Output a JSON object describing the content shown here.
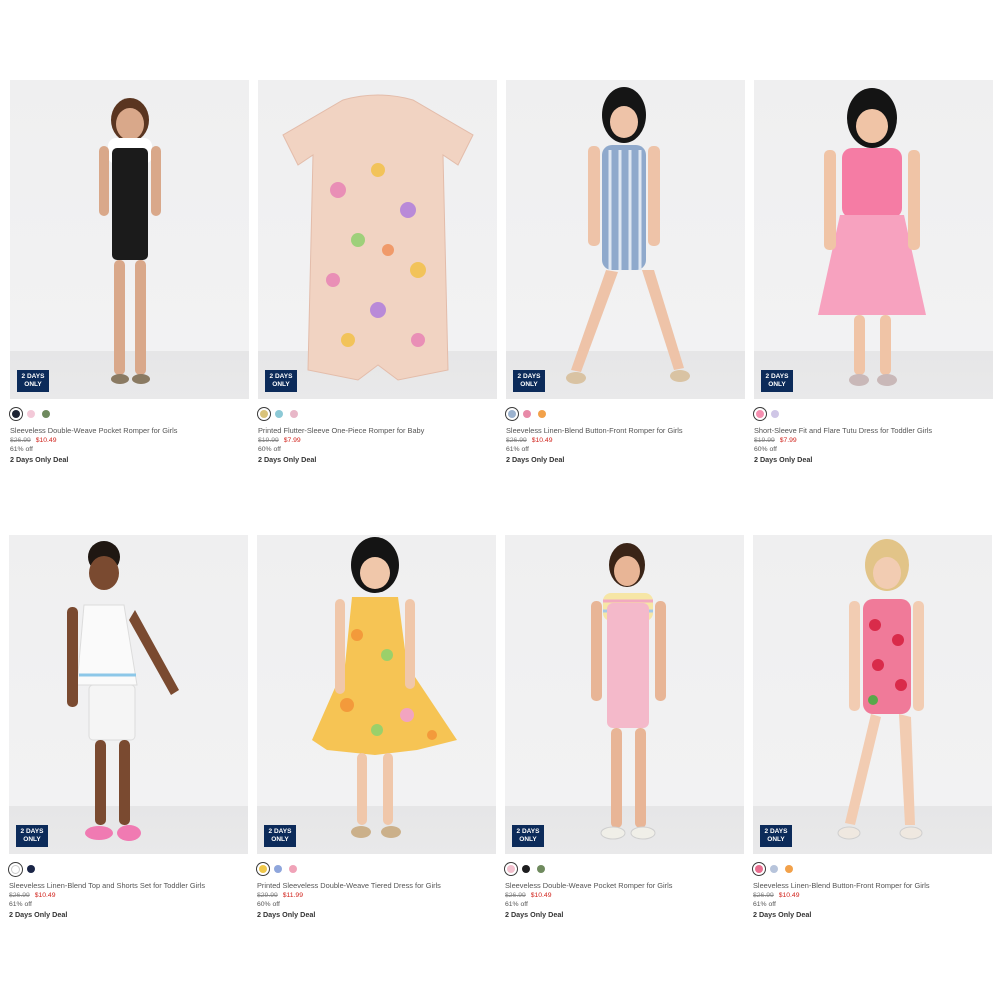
{
  "badge": {
    "line1": "2 DAYS",
    "line2": "ONLY"
  },
  "colors": {
    "badge_bg": "#0c2b5a",
    "sale_price": "#d1231c"
  },
  "products": [
    {
      "name": "Sleeveless Double-Weave Pocket Romper for Girls",
      "was_price": "$26.99",
      "now_price": "$10.49",
      "discount": "61% off",
      "deal": "2 Days Only Deal",
      "swatches": [
        "#1c2333",
        "#f3c9d8",
        "#6f8a5e"
      ]
    },
    {
      "name": "Printed Flutter-Sleeve One-Piece Romper for Baby",
      "was_price": "$19.99",
      "now_price": "$7.99",
      "discount": "60% off",
      "deal": "2 Days Only Deal",
      "swatches": [
        "#d9c37a",
        "#8cc9d6",
        "#e8b7c8"
      ]
    },
    {
      "name": "Sleeveless Linen-Blend Button-Front Romper for Girls",
      "was_price": "$26.99",
      "now_price": "$10.49",
      "discount": "61% off",
      "deal": "2 Days Only Deal",
      "swatches": [
        "#9bb2cf",
        "#e88aa8",
        "#f2a14a"
      ]
    },
    {
      "name": "Short-Sleeve Fit and Flare Tutu Dress for Toddler Girls",
      "was_price": "$19.99",
      "now_price": "$7.99",
      "discount": "60% off",
      "deal": "2 Days Only Deal",
      "swatches": [
        "#f58fb0",
        "#cfc6e6"
      ]
    },
    {
      "name": "Sleeveless Linen-Blend Top and Shorts Set for Toddler Girls",
      "was_price": "$26.99",
      "now_price": "$10.49",
      "discount": "61% off",
      "deal": "2 Days Only Deal",
      "swatches": [
        "#ffffff",
        "#1a2547"
      ]
    },
    {
      "name": "Printed Sleeveless Double-Weave Tiered Dress for Girls",
      "was_price": "$29.99",
      "now_price": "$11.99",
      "discount": "60% off",
      "deal": "2 Days Only Deal",
      "swatches": [
        "#f0c84a",
        "#8fa6dc",
        "#f0a3b8"
      ]
    },
    {
      "name": "Sleeveless Double-Weave Pocket Romper for Girls",
      "was_price": "$26.99",
      "now_price": "$10.49",
      "discount": "61% off",
      "deal": "2 Days Only Deal",
      "swatches": [
        "#f3c1cf",
        "#1d1d1f",
        "#6f8a5e"
      ]
    },
    {
      "name": "Sleeveless Linen-Blend Button-Front Romper for Girls",
      "was_price": "$26.99",
      "now_price": "$10.49",
      "discount": "61% off",
      "deal": "2 Days Only Deal",
      "swatches": [
        "#e86e8f",
        "#b7c4db",
        "#f2a14a"
      ]
    }
  ]
}
